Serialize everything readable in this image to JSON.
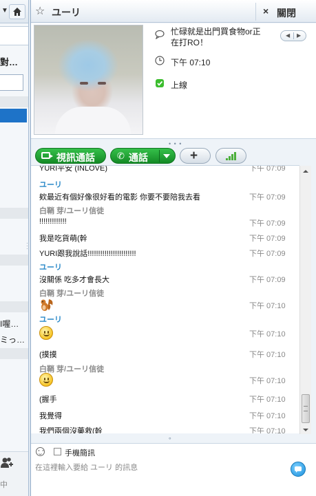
{
  "left_panel": {
    "title_fragment": "對…",
    "row_text_1": "I喔…",
    "row_text_2": "ミっ…",
    "status_fragment": "中"
  },
  "header": {
    "contact_name": "ユーリ",
    "close_label": "關閉"
  },
  "profile": {
    "mood_message": "忙碌就是出門買食物or正在打RO！",
    "local_time": "下午 07:10",
    "status": "上線"
  },
  "toolbar": {
    "video_call_label": "視訊通話",
    "call_label": "通話"
  },
  "chat": {
    "partial_top_line": {
      "text": "YURI平安 (INLOVE)",
      "time": "下午 07:09"
    },
    "entries": [
      {
        "type": "sender",
        "who": "me",
        "name": "ユーリ"
      },
      {
        "type": "message",
        "text": "欸最近有個好像很好看的電影 你要不要陪我去看",
        "time": "下午 07:09"
      },
      {
        "type": "sender",
        "who": "other",
        "name": "白鞘 芽/ユーリ信徒"
      },
      {
        "type": "message",
        "text": "!!!!!!!!!!!!!",
        "time": "下午 07:09"
      },
      {
        "type": "message",
        "text": "我是吃貨萌(幹",
        "time": "下午 07:09"
      },
      {
        "type": "message",
        "text": "YURI跟我說話!!!!!!!!!!!!!!!!!!!!!!!",
        "time": "下午 07:09"
      },
      {
        "type": "sender",
        "who": "me",
        "name": "ユーリ"
      },
      {
        "type": "message",
        "text": "沒關係 吃多才會長大",
        "time": "下午 07:09"
      },
      {
        "type": "sender",
        "who": "other",
        "name": "白鞘 芽/ユーリ信徒"
      },
      {
        "type": "emoticon",
        "icon": "squirrel-emoticon",
        "time": "下午 07:10"
      },
      {
        "type": "sender",
        "who": "me",
        "name": "ユーリ"
      },
      {
        "type": "emoticon",
        "icon": "smile-emoticon",
        "time": "下午 07:10"
      },
      {
        "type": "message",
        "text": "(摸摸",
        "time": "下午 07:10"
      },
      {
        "type": "sender",
        "who": "other",
        "name": "白鞘 芽/ユーリ信徒"
      },
      {
        "type": "emoticon",
        "icon": "smile-emoticon",
        "time": "下午 07:10"
      },
      {
        "type": "message",
        "text": "(握手",
        "time": "下午 07:10"
      },
      {
        "type": "message",
        "text": "我覺得",
        "time": "下午 07:10"
      },
      {
        "type": "message",
        "text": "我們兩個沒藥救(幹",
        "time": "下午 07:10"
      }
    ]
  },
  "input_bar": {
    "sms_label": "手機簡訊",
    "message_placeholder": "在這裡輸入要給 ユーリ 的訊息"
  },
  "colors": {
    "accent_blue": "#1e73c8",
    "sender_me": "#2a89c8",
    "sender_other": "#8a8a8a",
    "call_green": "#148a26",
    "online_green": "#3cbd2e"
  }
}
